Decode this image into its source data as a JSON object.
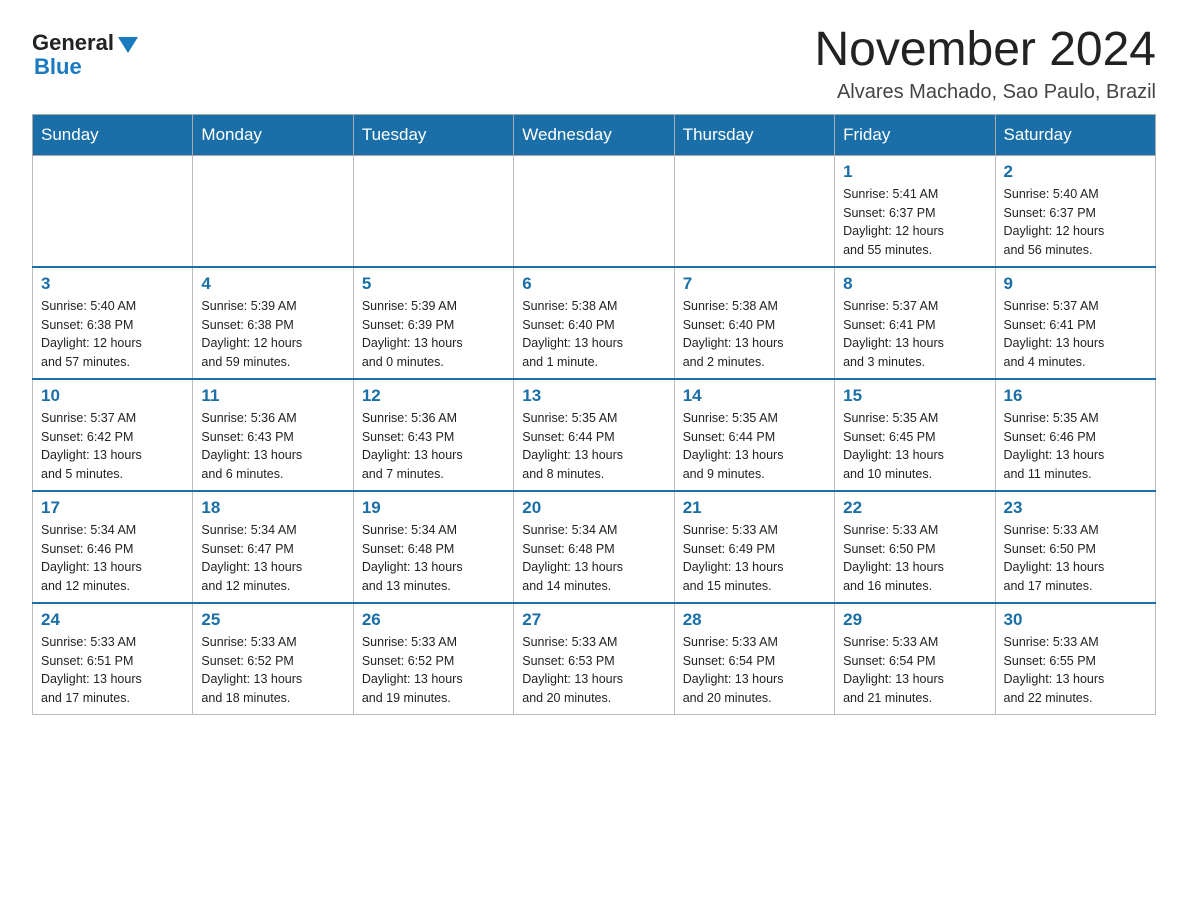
{
  "logo": {
    "general": "General",
    "blue": "Blue"
  },
  "title": "November 2024",
  "location": "Alvares Machado, Sao Paulo, Brazil",
  "weekdays": [
    "Sunday",
    "Monday",
    "Tuesday",
    "Wednesday",
    "Thursday",
    "Friday",
    "Saturday"
  ],
  "weeks": [
    [
      {
        "day": "",
        "info": ""
      },
      {
        "day": "",
        "info": ""
      },
      {
        "day": "",
        "info": ""
      },
      {
        "day": "",
        "info": ""
      },
      {
        "day": "",
        "info": ""
      },
      {
        "day": "1",
        "info": "Sunrise: 5:41 AM\nSunset: 6:37 PM\nDaylight: 12 hours\nand 55 minutes."
      },
      {
        "day": "2",
        "info": "Sunrise: 5:40 AM\nSunset: 6:37 PM\nDaylight: 12 hours\nand 56 minutes."
      }
    ],
    [
      {
        "day": "3",
        "info": "Sunrise: 5:40 AM\nSunset: 6:38 PM\nDaylight: 12 hours\nand 57 minutes."
      },
      {
        "day": "4",
        "info": "Sunrise: 5:39 AM\nSunset: 6:38 PM\nDaylight: 12 hours\nand 59 minutes."
      },
      {
        "day": "5",
        "info": "Sunrise: 5:39 AM\nSunset: 6:39 PM\nDaylight: 13 hours\nand 0 minutes."
      },
      {
        "day": "6",
        "info": "Sunrise: 5:38 AM\nSunset: 6:40 PM\nDaylight: 13 hours\nand 1 minute."
      },
      {
        "day": "7",
        "info": "Sunrise: 5:38 AM\nSunset: 6:40 PM\nDaylight: 13 hours\nand 2 minutes."
      },
      {
        "day": "8",
        "info": "Sunrise: 5:37 AM\nSunset: 6:41 PM\nDaylight: 13 hours\nand 3 minutes."
      },
      {
        "day": "9",
        "info": "Sunrise: 5:37 AM\nSunset: 6:41 PM\nDaylight: 13 hours\nand 4 minutes."
      }
    ],
    [
      {
        "day": "10",
        "info": "Sunrise: 5:37 AM\nSunset: 6:42 PM\nDaylight: 13 hours\nand 5 minutes."
      },
      {
        "day": "11",
        "info": "Sunrise: 5:36 AM\nSunset: 6:43 PM\nDaylight: 13 hours\nand 6 minutes."
      },
      {
        "day": "12",
        "info": "Sunrise: 5:36 AM\nSunset: 6:43 PM\nDaylight: 13 hours\nand 7 minutes."
      },
      {
        "day": "13",
        "info": "Sunrise: 5:35 AM\nSunset: 6:44 PM\nDaylight: 13 hours\nand 8 minutes."
      },
      {
        "day": "14",
        "info": "Sunrise: 5:35 AM\nSunset: 6:44 PM\nDaylight: 13 hours\nand 9 minutes."
      },
      {
        "day": "15",
        "info": "Sunrise: 5:35 AM\nSunset: 6:45 PM\nDaylight: 13 hours\nand 10 minutes."
      },
      {
        "day": "16",
        "info": "Sunrise: 5:35 AM\nSunset: 6:46 PM\nDaylight: 13 hours\nand 11 minutes."
      }
    ],
    [
      {
        "day": "17",
        "info": "Sunrise: 5:34 AM\nSunset: 6:46 PM\nDaylight: 13 hours\nand 12 minutes."
      },
      {
        "day": "18",
        "info": "Sunrise: 5:34 AM\nSunset: 6:47 PM\nDaylight: 13 hours\nand 12 minutes."
      },
      {
        "day": "19",
        "info": "Sunrise: 5:34 AM\nSunset: 6:48 PM\nDaylight: 13 hours\nand 13 minutes."
      },
      {
        "day": "20",
        "info": "Sunrise: 5:34 AM\nSunset: 6:48 PM\nDaylight: 13 hours\nand 14 minutes."
      },
      {
        "day": "21",
        "info": "Sunrise: 5:33 AM\nSunset: 6:49 PM\nDaylight: 13 hours\nand 15 minutes."
      },
      {
        "day": "22",
        "info": "Sunrise: 5:33 AM\nSunset: 6:50 PM\nDaylight: 13 hours\nand 16 minutes."
      },
      {
        "day": "23",
        "info": "Sunrise: 5:33 AM\nSunset: 6:50 PM\nDaylight: 13 hours\nand 17 minutes."
      }
    ],
    [
      {
        "day": "24",
        "info": "Sunrise: 5:33 AM\nSunset: 6:51 PM\nDaylight: 13 hours\nand 17 minutes."
      },
      {
        "day": "25",
        "info": "Sunrise: 5:33 AM\nSunset: 6:52 PM\nDaylight: 13 hours\nand 18 minutes."
      },
      {
        "day": "26",
        "info": "Sunrise: 5:33 AM\nSunset: 6:52 PM\nDaylight: 13 hours\nand 19 minutes."
      },
      {
        "day": "27",
        "info": "Sunrise: 5:33 AM\nSunset: 6:53 PM\nDaylight: 13 hours\nand 20 minutes."
      },
      {
        "day": "28",
        "info": "Sunrise: 5:33 AM\nSunset: 6:54 PM\nDaylight: 13 hours\nand 20 minutes."
      },
      {
        "day": "29",
        "info": "Sunrise: 5:33 AM\nSunset: 6:54 PM\nDaylight: 13 hours\nand 21 minutes."
      },
      {
        "day": "30",
        "info": "Sunrise: 5:33 AM\nSunset: 6:55 PM\nDaylight: 13 hours\nand 22 minutes."
      }
    ]
  ]
}
